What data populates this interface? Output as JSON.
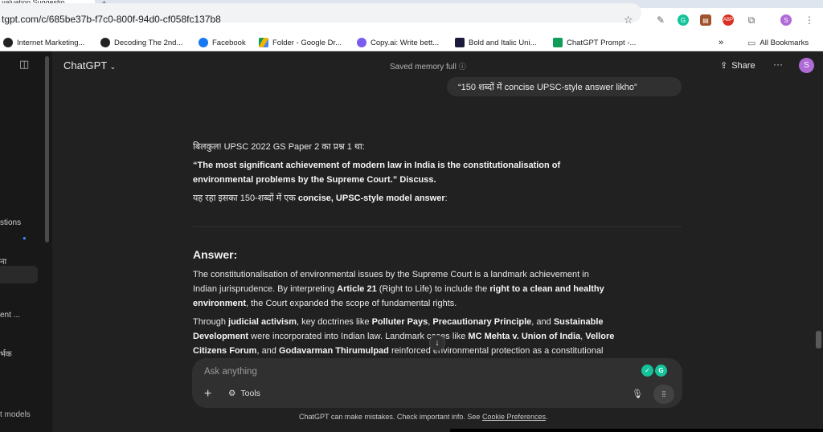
{
  "browser": {
    "tab_title": "valuation Suggestio",
    "url": "tgpt.com/c/685be37b-f7c0-800f-94d0-cf058fc137b8",
    "bookmarks": [
      {
        "label": "Internet Marketing..."
      },
      {
        "label": "Decoding The 2nd..."
      },
      {
        "label": "Facebook"
      },
      {
        "label": "Folder - Google Dr..."
      },
      {
        "label": "Copy.ai: Write bett..."
      },
      {
        "label": "Bold and Italic Uni..."
      },
      {
        "label": "ChatGPT Prompt -..."
      }
    ],
    "overflow": "»",
    "all_bookmarks": "All Bookmarks",
    "profile_initial": "S",
    "ext_abp": "ABP"
  },
  "sidebar": {
    "items": [
      {
        "label": "stions"
      },
      {
        "label": "ना"
      },
      {
        "label": "ent ..."
      },
      {
        "label": "र्भक"
      },
      {
        "label": "t models"
      }
    ]
  },
  "header": {
    "model": "ChatGPT",
    "memory_status": "Saved memory full",
    "share_label": "Share",
    "more": "···",
    "avatar_initial": "S"
  },
  "chat": {
    "user_message": "“150 शब्दों में concise UPSC-style answer likho”",
    "intro": "बिलकुल! UPSC 2022 GS Paper 2 का प्रश्न 1 था:",
    "question_line1": "“The most significant achievement of modern law in India is the constitutionalisation of",
    "question_line2": "environmental problems by the Supreme Court.” Discuss.",
    "model_answer_prefix": "यह रहा इसका 150-शब्दों में एक ",
    "model_answer_bold": "concise, UPSC-style model answer",
    "model_answer_suffix": ":",
    "answer_heading": "Answer:",
    "p1": {
      "a": "The constitutionalisation of environmental issues by the Supreme Court is a landmark achievement in",
      "b": "Indian jurisprudence. By interpreting ",
      "c": "Article 21",
      "d": " (Right to Life) to include the ",
      "e": "right to a clean and healthy",
      "f": "environment",
      "g": ", the Court expanded the scope of fundamental rights."
    },
    "p2": {
      "a": "Through ",
      "b": "judicial activism",
      "c": ", key doctrines like ",
      "d": "Polluter Pays",
      "e": ", ",
      "f": "Precautionary Principle",
      "g": ", and ",
      "h": "Sustainable",
      "i": "Development",
      "j": " were incorporated into Indian law. Landmark cases like ",
      "k": "MC Mehta v. Union of India",
      "l": ", ",
      "m": "Vellore",
      "n": "Citizens Forum",
      "o": ", and ",
      "p": "Godavarman Thirumulpad",
      "q": " reinforced environmental protection as a constitutional"
    }
  },
  "composer": {
    "placeholder": "Ask anything",
    "tools_label": "Tools"
  },
  "footer": {
    "text": "ChatGPT can make mistakes. Check important info. See ",
    "link": "Cookie Preferences",
    "end": "."
  }
}
